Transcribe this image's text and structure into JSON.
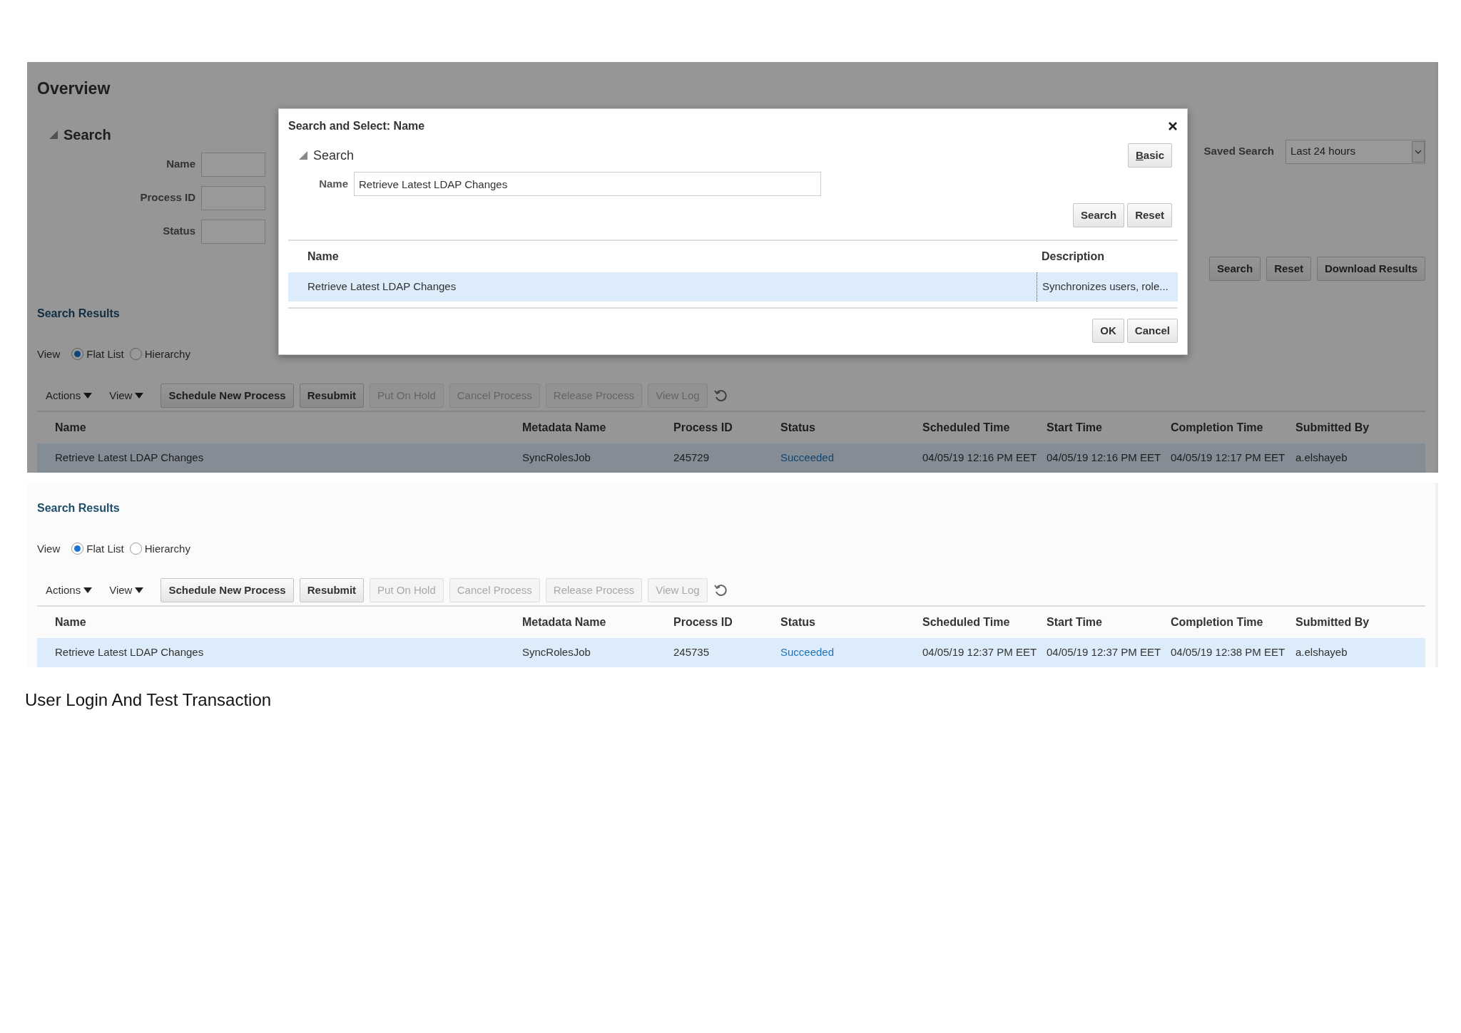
{
  "screenshots": [
    {
      "title": "Overview",
      "search": {
        "title": "Search",
        "fields": [
          {
            "label": "Name"
          },
          {
            "label": "Process ID"
          },
          {
            "label": "Status"
          }
        ],
        "saved_search": {
          "label": "Saved Search",
          "value": "Last 24 hours"
        },
        "buttons": [
          "Search",
          "Reset",
          "Download Results"
        ]
      },
      "results": {
        "title": "Search Results",
        "view_label": "View",
        "view_options": [
          {
            "label": "Flat List",
            "selected": true
          },
          {
            "label": "Hierarchy",
            "selected": false
          }
        ],
        "menus": [
          "Actions",
          "View"
        ],
        "buttons": [
          {
            "label": "Schedule New Process",
            "disabled": false
          },
          {
            "label": "Resubmit",
            "disabled": false
          },
          {
            "label": "Put On Hold",
            "disabled": true
          },
          {
            "label": "Cancel Process",
            "disabled": true
          },
          {
            "label": "Release Process",
            "disabled": true
          },
          {
            "label": "View Log",
            "disabled": true
          }
        ],
        "columns": [
          {
            "label": "Name",
            "kind": "text"
          },
          {
            "label": "Metadata Name",
            "kind": "text"
          },
          {
            "label": "Process ID",
            "kind": "text"
          },
          {
            "label": "Status",
            "kind": "status"
          },
          {
            "label": "Scheduled Time",
            "kind": "text"
          },
          {
            "label": "Start Time",
            "kind": "text"
          },
          {
            "label": "Completion Time",
            "kind": "text"
          },
          {
            "label": "Submitted By",
            "kind": "text"
          }
        ],
        "rows": [
          {
            "selected": true,
            "cells": [
              "Retrieve Latest LDAP Changes",
              "SyncRolesJob",
              "245729",
              "Succeeded",
              "04/05/19 12:16 PM EET",
              "04/05/19 12:16 PM EET",
              "04/05/19 12:17 PM EET",
              "a.elshayeb"
            ]
          }
        ]
      },
      "dialog": {
        "title": "Search and Select: Name",
        "section": "Search",
        "mode_button": "Basic",
        "fields": [
          {
            "label": "Name",
            "value": "Retrieve Latest LDAP Changes"
          }
        ],
        "buttons": [
          "Search",
          "Reset"
        ],
        "columns": [
          "Name",
          "Description"
        ],
        "rows": [
          {
            "selected": true,
            "cells": [
              "Retrieve Latest LDAP Changes",
              "Synchronizes users, role..."
            ]
          }
        ],
        "footer_buttons": [
          "OK",
          "Cancel"
        ]
      }
    },
    {
      "results": {
        "title": "Search Results",
        "view_label": "View",
        "view_options": [
          {
            "label": "Flat List",
            "selected": true
          },
          {
            "label": "Hierarchy",
            "selected": false
          }
        ],
        "menus": [
          "Actions",
          "View"
        ],
        "buttons": [
          {
            "label": "Schedule New Process",
            "disabled": false
          },
          {
            "label": "Resubmit",
            "disabled": false
          },
          {
            "label": "Put On Hold",
            "disabled": true
          },
          {
            "label": "Cancel Process",
            "disabled": true
          },
          {
            "label": "Release Process",
            "disabled": true
          },
          {
            "label": "View Log",
            "disabled": true
          }
        ],
        "columns": [
          {
            "label": "Name",
            "kind": "text"
          },
          {
            "label": "Metadata Name",
            "kind": "text"
          },
          {
            "label": "Process ID",
            "kind": "text"
          },
          {
            "label": "Status",
            "kind": "status"
          },
          {
            "label": "Scheduled Time",
            "kind": "text"
          },
          {
            "label": "Start Time",
            "kind": "text"
          },
          {
            "label": "Completion Time",
            "kind": "text"
          },
          {
            "label": "Submitted By",
            "kind": "text"
          }
        ],
        "rows": [
          {
            "selected": true,
            "cells": [
              "Retrieve Latest LDAP Changes",
              "SyncRolesJob",
              "245735",
              "Succeeded",
              "04/05/19 12:37 PM EET",
              "04/05/19 12:37 PM EET",
              "04/05/19 12:38 PM EET",
              "a.elshayeb"
            ]
          }
        ]
      }
    }
  ],
  "caption": "User Login And Test Transaction"
}
